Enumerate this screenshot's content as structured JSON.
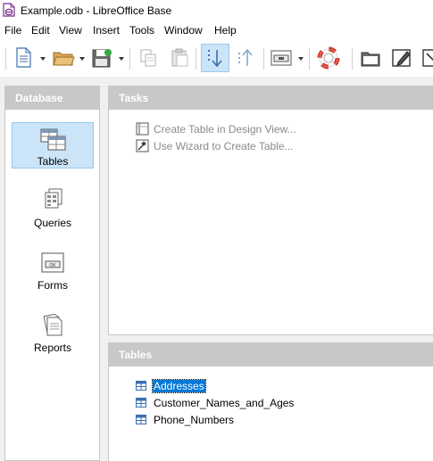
{
  "window": {
    "title": "Example.odb - LibreOffice Base",
    "app_icon": "libreoffice-base-icon"
  },
  "menu": [
    "File",
    "Edit",
    "View",
    "Insert",
    "Tools",
    "Window",
    "Help"
  ],
  "toolbar": {
    "buttons": [
      "new-document-icon",
      "open-folder-icon",
      "save-icon",
      "copy-icon",
      "paste-icon",
      "sort-descending-icon",
      "sort-ascending-icon",
      "form-control-icon",
      "help-lifebuoy-icon",
      "open-database-object-icon",
      "edit-icon",
      "delete-icon"
    ]
  },
  "database_panel": {
    "header": "Database",
    "items": [
      {
        "label": "Tables",
        "icon": "tables-icon",
        "selected": true
      },
      {
        "label": "Queries",
        "icon": "queries-icon",
        "selected": false
      },
      {
        "label": "Forms",
        "icon": "forms-icon",
        "selected": false
      },
      {
        "label": "Reports",
        "icon": "reports-icon",
        "selected": false
      }
    ]
  },
  "tasks_panel": {
    "header": "Tasks",
    "tasks": [
      {
        "label": "Create Table in Design View...",
        "icon": "design-view-icon"
      },
      {
        "label": "Use Wizard to Create Table...",
        "icon": "wizard-icon"
      }
    ]
  },
  "tables_panel": {
    "header": "Tables",
    "tables": [
      {
        "name": "Addresses",
        "selected": true
      },
      {
        "name": "Customer_Names_and_Ages",
        "selected": false
      },
      {
        "name": "Phone_Numbers",
        "selected": false
      }
    ]
  },
  "colors": {
    "selection_fill": "#cce4f7",
    "selection_border": "#99c9ef",
    "selected_row": "#0078d7",
    "panel_header": "#c8c8c8",
    "workspace": "#f0f0f0"
  }
}
